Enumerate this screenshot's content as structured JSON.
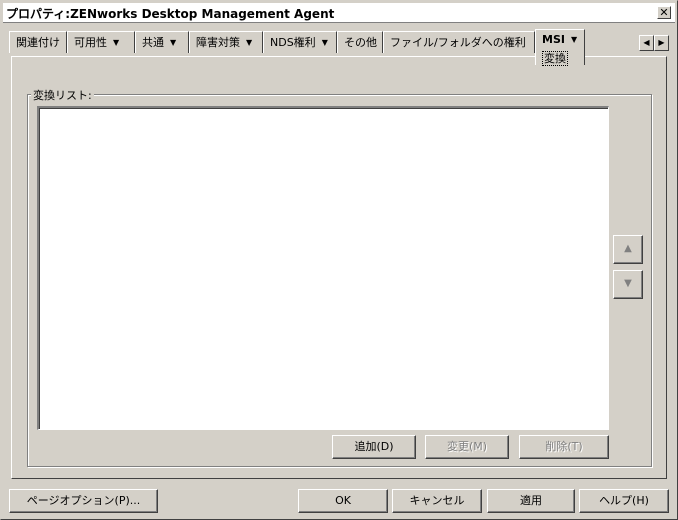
{
  "window": {
    "title": "プロパティ:ZENworks Desktop Management Agent",
    "close_label": "✕"
  },
  "tabs": [
    {
      "label": "関連付け",
      "has_menu": false
    },
    {
      "label": "可用性",
      "has_menu": true
    },
    {
      "label": "共通",
      "has_menu": true
    },
    {
      "label": "障害対策",
      "has_menu": true
    },
    {
      "label": "NDS権利",
      "has_menu": true
    },
    {
      "label": "その他",
      "has_menu": false
    },
    {
      "label": "ファイル/フォルダへの権利",
      "has_menu": false
    }
  ],
  "active_tab": {
    "label": "MSI",
    "sub_label": "変換",
    "arrow": "▼"
  },
  "tab_scroll": {
    "left": "◀",
    "right": "▶"
  },
  "content": {
    "group_label": "変換リスト:",
    "list_items": [],
    "buttons": {
      "add": "追加(D)",
      "modify": "変更(M)",
      "delete": "削除(T)"
    },
    "move_up": "▲",
    "move_down": "▼"
  },
  "footer": {
    "page_options": "ページオプション(P)...",
    "ok": "OK",
    "cancel": "キャンセル",
    "apply": "適用",
    "help": "ヘルプ(H)"
  }
}
